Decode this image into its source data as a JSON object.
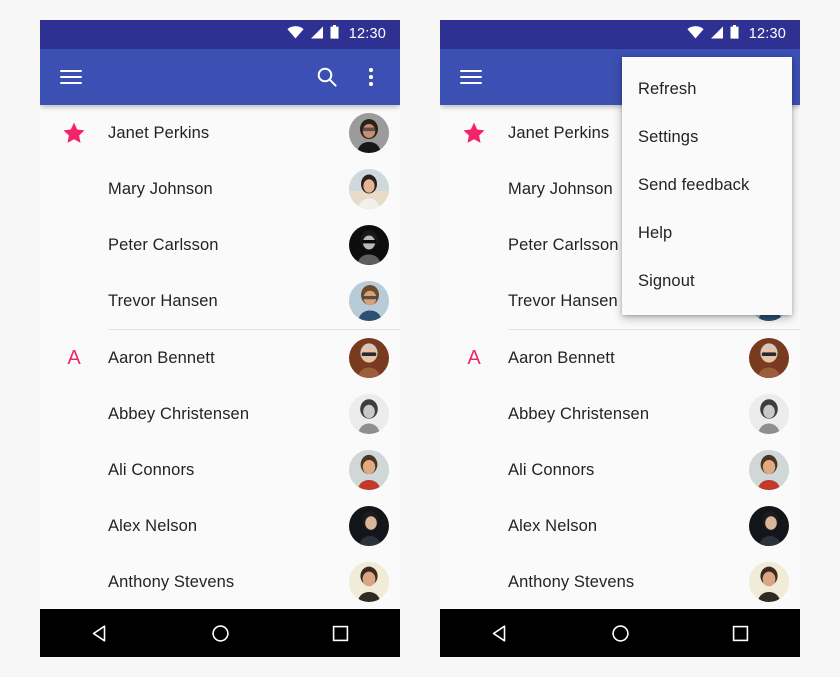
{
  "statusbar": {
    "time": "12:30",
    "icons": [
      "wifi-icon",
      "signal-icon",
      "battery-icon"
    ]
  },
  "appbar": {
    "menu_icon": "hamburger-menu-icon",
    "search_icon": "search-icon",
    "overflow_icon": "overflow-menu-icon"
  },
  "sections": [
    {
      "lead_type": "star",
      "lead_label": "★",
      "contacts": [
        {
          "name": "Janet Perkins"
        },
        {
          "name": "Mary Johnson"
        },
        {
          "name": "Peter Carlsson"
        },
        {
          "name": "Trevor Hansen"
        }
      ]
    },
    {
      "lead_type": "letter",
      "lead_label": "A",
      "contacts": [
        {
          "name": "Aaron Bennett"
        },
        {
          "name": "Abbey Christensen"
        },
        {
          "name": "Ali Connors"
        },
        {
          "name": "Alex Nelson"
        },
        {
          "name": "Anthony Stevens"
        }
      ]
    }
  ],
  "overflow_menu": {
    "items": [
      {
        "label": "Refresh"
      },
      {
        "label": "Settings"
      },
      {
        "label": "Send feedback"
      },
      {
        "label": "Help"
      },
      {
        "label": "Signout"
      }
    ]
  },
  "navbar": {
    "back": "back-triangle-icon",
    "home": "home-circle-icon",
    "recents": "recents-square-icon"
  },
  "colors": {
    "statusbar": "#2f3192",
    "appbar": "#3c4fb3",
    "accent_pink": "#f4246c",
    "surface": "#fafafa",
    "page_bg": "#f7f7f8",
    "text_primary": "#232323",
    "divider": "#e4e4e6",
    "navbar": "#000000"
  }
}
